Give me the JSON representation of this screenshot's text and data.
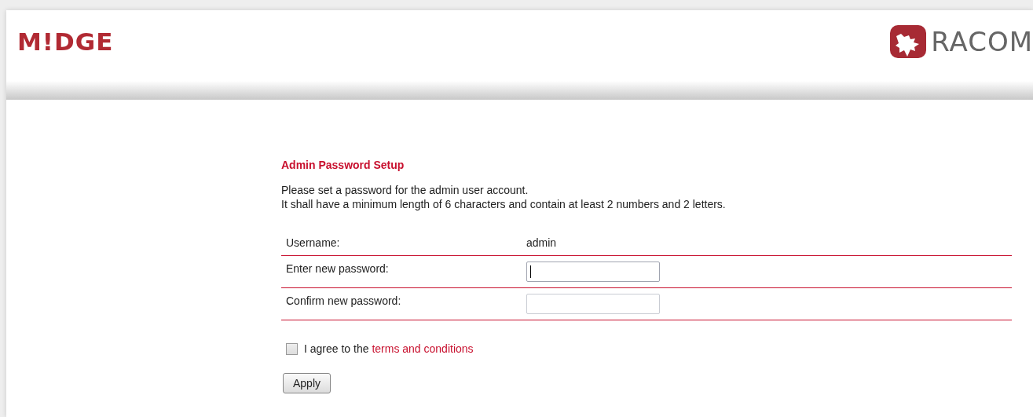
{
  "header": {
    "product_logo": "M!DGE",
    "company_logo": "RACOM"
  },
  "form": {
    "title": "Admin Password Setup",
    "intro": [
      "Please set a password for the admin user account.",
      "It shall have a minimum length of 6 characters and contain at least 2 numbers and 2 letters."
    ],
    "rows": [
      {
        "kind": "text",
        "label": "Username:",
        "value": "admin"
      },
      {
        "kind": "input",
        "label": "Enter new password:",
        "focused": true
      },
      {
        "kind": "input",
        "label": "Confirm new password:",
        "focused": false
      }
    ],
    "agree": {
      "checked": false,
      "text": "I agree to the ",
      "link": "terms and conditions"
    },
    "button": "Apply"
  }
}
